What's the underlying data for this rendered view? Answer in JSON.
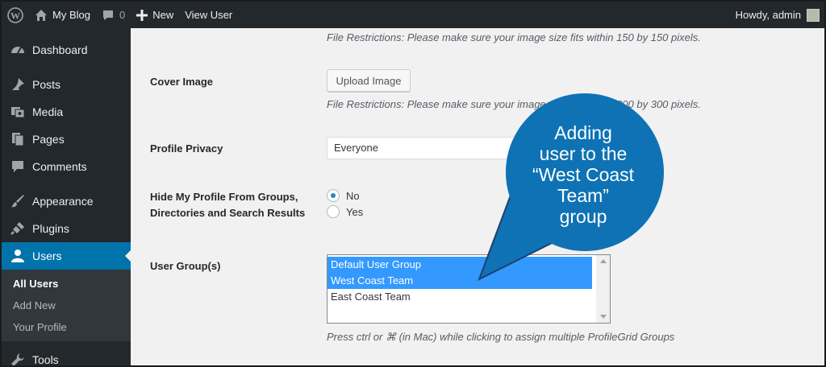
{
  "adminbar": {
    "site_name": "My Blog",
    "comments_count": "0",
    "new_label": "New",
    "view_user_label": "View User",
    "howdy": "Howdy, admin"
  },
  "sidebar": {
    "items": [
      {
        "label": "Dashboard",
        "icon": "dashboard-icon"
      },
      {
        "label": "Posts",
        "icon": "pin-icon"
      },
      {
        "label": "Media",
        "icon": "media-icon"
      },
      {
        "label": "Pages",
        "icon": "pages-icon"
      },
      {
        "label": "Comments",
        "icon": "comment-icon"
      },
      {
        "label": "Appearance",
        "icon": "brush-icon"
      },
      {
        "label": "Plugins",
        "icon": "plug-icon"
      },
      {
        "label": "Users",
        "icon": "user-icon"
      },
      {
        "label": "Tools",
        "icon": "wrench-icon"
      }
    ],
    "submenu": [
      "All Users",
      "Add New",
      "Your Profile"
    ]
  },
  "form": {
    "file_restriction_1": "File Restrictions: Please make sure your image size fits within 150 by 150 pixels.",
    "cover_image_label": "Cover Image",
    "upload_button": "Upload Image",
    "file_restriction_2": "File Restrictions: Please make sure your image size fits within 800 by 300 pixels.",
    "profile_privacy_label": "Profile Privacy",
    "profile_privacy_value": "Everyone",
    "hide_profile_label_1": "Hide My Profile From Groups,",
    "hide_profile_label_2": "Directories and Search Results",
    "radio_no": "No",
    "radio_yes": "Yes",
    "user_groups_label": "User Group(s)",
    "groups": [
      {
        "label": "Default User Group",
        "selected": true
      },
      {
        "label": "West Coast Team",
        "selected": true
      },
      {
        "label": "East Coast Team",
        "selected": false
      }
    ],
    "groups_hint": "Press ctrl or ⌘ (in Mac) while clicking to assign multiple ProfileGrid Groups"
  },
  "callout": {
    "lines": [
      "Adding",
      "user to the",
      "“West Coast",
      "Team”",
      "group"
    ],
    "color": "#0e72b5"
  },
  "colors": {
    "adminbar": "#23282d",
    "accent": "#0073aa",
    "selection": "#3399ff"
  }
}
